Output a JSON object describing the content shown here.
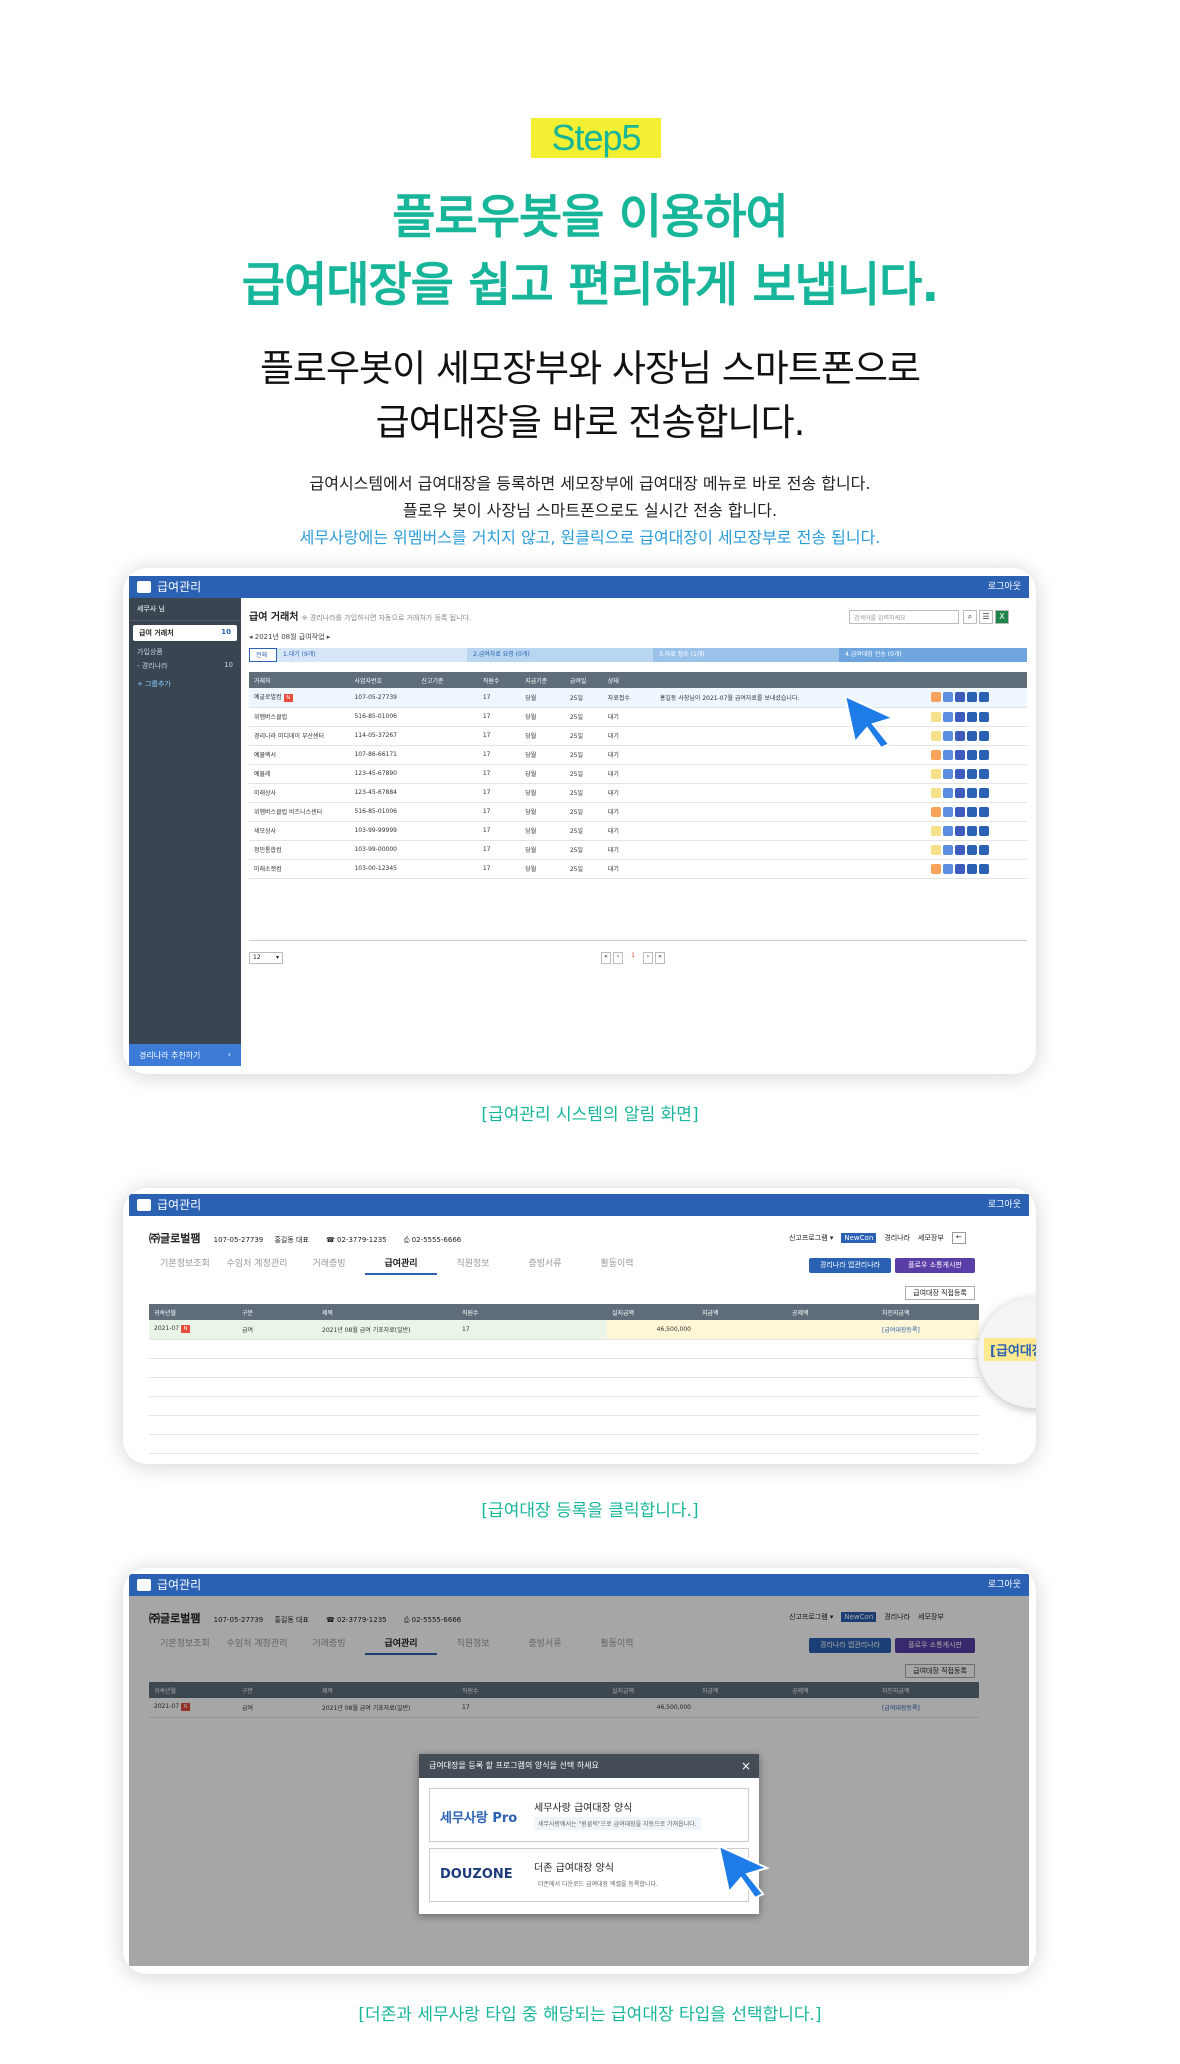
{
  "hero": {
    "step": "Step5",
    "headline_1": "플로우봇을 이용하여",
    "headline_2": "급여대장을 쉽고 편리하게 보냅니다.",
    "subhead_1": "플로우봇이 세모장부와 사장님 스마트폰으로",
    "subhead_2": "급여대장을 바로 전송합니다.",
    "desc_1": "급여시스템에서 급여대장을 등록하면 세모장부에 급여대장 메뉴로 바로 전송 합니다.",
    "desc_2": "플로우 봇이 사장님 스마트폰으로도 실시간 전송 합니다.",
    "desc_3": "세무사랑에는 위멤버스를 거치지 않고, 원클릭으로 급여대장이 세모장부로 전송 됩니다."
  },
  "colors": {
    "accent": "#17b59a",
    "highlight": "#f3ef32",
    "titlebar": "#2a61b3",
    "sidebar": "#394652",
    "link": "#2b9cd8"
  },
  "shot1": {
    "app_title": "급여관리",
    "login": "로그아웃",
    "sidebar": {
      "user": "세무사 님",
      "active_menu": "급여 거래처",
      "active_count": "10",
      "group_label": "가입상품",
      "sub_item": "- 경리나라",
      "sub_count": "10",
      "add_group": "+ 그룹추가",
      "recommend": "경리나라 추천하기"
    },
    "page_title": "급여 거래처",
    "page_note": "※ 경리나라를 가입하시면 자동으로 거래처가 등록 됩니다.",
    "search_placeholder": "검색어를 입력하세요",
    "period": "◂ 2021년 08월 급여작업 ▸",
    "filter_all": "전체",
    "steps": [
      "1.대기 (9개)",
      "2.급여자료 요청 (0개)",
      "3.자료 접수 (1개)",
      "4.급여대장 전송 (0개)"
    ],
    "columns": [
      "거래처",
      "사업자번호",
      "신고기준",
      "직원수",
      "지급기준",
      "급여일",
      "상태"
    ],
    "rows": [
      [
        "예글로벌컴",
        "107-05-27739",
        "",
        "17",
        "당월",
        "25일",
        "자료접수",
        "홍길동 사장님이 2021-07월 급여자료를 보내셨습니다."
      ],
      [
        "위멤버스클럽",
        "516-85-01006",
        "",
        "17",
        "당월",
        "25일",
        "대기",
        ""
      ],
      [
        "경리나라 미디데이 부산센터",
        "114-05-37267",
        "",
        "17",
        "당월",
        "25일",
        "대기",
        ""
      ],
      [
        "예뮬렉서",
        "107-86-66171",
        "",
        "17",
        "당월",
        "25일",
        "대기",
        ""
      ],
      [
        "예뮬레",
        "123-45-67890",
        "",
        "17",
        "당월",
        "25일",
        "대기",
        ""
      ],
      [
        "미래상사",
        "123-45-67884",
        "",
        "17",
        "당월",
        "25일",
        "대기",
        ""
      ],
      [
        "위멤버스클럽 비즈니스센터",
        "516-85-01006",
        "",
        "17",
        "당월",
        "25일",
        "대기",
        ""
      ],
      [
        "세모상사",
        "103-99-99999",
        "",
        "17",
        "당월",
        "25일",
        "대기",
        ""
      ],
      [
        "정민통합컴",
        "103-99-00000",
        "",
        "17",
        "당월",
        "25일",
        "대기",
        ""
      ],
      [
        "미래소켓컴",
        "103-00-12345",
        "",
        "17",
        "당월",
        "25일",
        "대기",
        ""
      ]
    ],
    "page_size": "12",
    "pager": [
      "«",
      "‹",
      "1",
      "›",
      "»"
    ]
  },
  "caption_1": "[급여관리 시스템의 알림 화면]",
  "shot2": {
    "app_title": "급여관리",
    "login": "로그아웃",
    "company": "㈜글로벌팸",
    "biz_no": "107-05-27739",
    "ceo": "홍길동 대표",
    "phone": "☎ 02-3779-1235",
    "fax": "⎙ 02-5555-6666",
    "right_links": [
      "신고프로그램 ▾",
      "NewCon",
      "경리나라",
      "세모장부"
    ],
    "tabs": [
      "기본정보조회",
      "수임처 계정관리",
      "거래증빙",
      "급여관리",
      "직원정보",
      "증빙서류",
      "활동이력"
    ],
    "btn_primary": "경리나라 앱관리나라",
    "btn_flow": "플로우 소통게시판",
    "btn_register": "급여대장 직접등록",
    "columns": [
      "귀속년월",
      "구분",
      "제목",
      "직원수",
      "실지급액",
      "지급액",
      "공제액",
      "차인지급액"
    ],
    "row": [
      "2021-07",
      "급여",
      "2021년 08월 급여 기초자료(일반)",
      "17",
      "46,500,000",
      "",
      "",
      "[급여대장등록]"
    ],
    "magnifier_label": "[급여대장등록]"
  },
  "caption_2": "[급여대장 등록을 클릭합니다.]",
  "shot3": {
    "modal_title": "급여대장을 등록 할 프로그램의 양식을 선택 하세요",
    "close": "×",
    "option1_brand": "세무사랑 Pro",
    "option1_title": "세무사랑 급여대장 양식",
    "option1_desc": "세무사랑에서는 \"원클릭\"으로 급여대장을 자동으로 가져옵니다.",
    "option2_brand": "DOUZONE",
    "option2_title": "더존 급여대장 양식",
    "option2_desc": "더존에서 다운로드 급여대장 엑셀을 등록합니다."
  },
  "caption_3": "[더존과 세무사랑 타입 중 해당되는 급여대장 타입을 선택합니다.]"
}
